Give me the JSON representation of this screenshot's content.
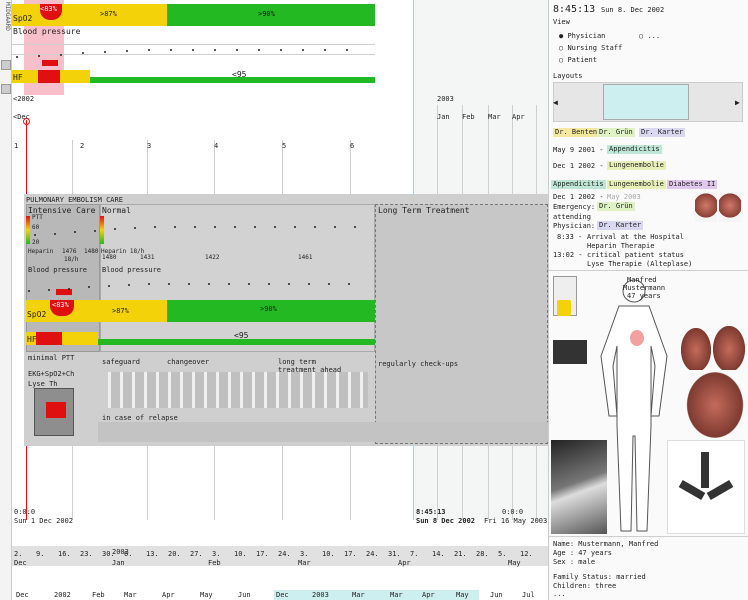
{
  "app": {
    "sidebar_brand": "MIDGAARD",
    "accent_green": "#22b922",
    "accent_yellow": "#f4d20a",
    "accent_red": "#e01010",
    "highlight_pink": "#f6b4c0",
    "highlight_cyan": "#cdeff0"
  },
  "overview": {
    "spo2_label": "SpO2",
    "spo2_bands": [
      "<83%",
      ">87%",
      ">90%"
    ],
    "bp_label": "Blood pressure",
    "hf_label": "HF",
    "hf_value": "<95",
    "left_marker": "<2002",
    "dec_marker": "<Dec",
    "year_2003": "2003",
    "months": [
      "Jan",
      "Feb",
      "Mar",
      "Apr"
    ],
    "day_ticks": [
      "1",
      "2",
      "3",
      "4",
      "5",
      "6"
    ]
  },
  "detail": {
    "section_title": "PULMONARY EMBOLISM CARE",
    "intensive_care": "Intensive Care",
    "normal": "Normal",
    "long_term": "Long Term Treatment",
    "heparin_a": "Heparin",
    "heparin_b": "Heparin 18/h",
    "heparin_values": [
      "1476",
      "1480",
      "1431",
      "1422",
      "1461",
      "1480"
    ],
    "rate": "18/h",
    "ptt_label": "PTT",
    "scale_60": "60",
    "scale_20": "20",
    "bp_label": "Blood pressure",
    "spo2_label": "SpO2",
    "spo2_bands": [
      "<83%",
      ">87%",
      ">90%"
    ],
    "hf_label": "HF",
    "hf_value": "<95",
    "minimal_ptt": "minimal PTT",
    "ekg": "EKG+SpO2+Ch",
    "lyse": "Lyse Th",
    "safeguard": "safeguard",
    "changeover": "changeover",
    "long_term_ahead_1": "long term",
    "long_term_ahead_2": "treatment ahead",
    "checkups": "regularly check-ups",
    "relapse": "in case of relapse"
  },
  "timeline": {
    "start_time": "0:0:0",
    "start_date": "Sun 1 Dec 2002",
    "now_time": "8:45:13",
    "now_date": "Sun 8 Dec 2002",
    "end_time": "0:0:0",
    "end_date": "Fri 16 May 2003",
    "day_row": [
      "2.",
      "9.",
      "16.",
      "23.",
      "30.",
      "6.",
      "13.",
      "20.",
      "27.",
      "3.",
      "10.",
      "17.",
      "24.",
      "3.",
      "10.",
      "17.",
      "24.",
      "31.",
      "7.",
      "14.",
      "21.",
      "28.",
      "5.",
      "12."
    ],
    "month_row": [
      "Dec",
      "Jan",
      "Feb",
      "Mar",
      "Apr",
      "May"
    ],
    "year_row_label": "2003",
    "bottom_row_left": [
      "Dec",
      "2002",
      "Feb",
      "Mar",
      "Apr",
      "May",
      "Jun"
    ],
    "bottom_row_right": [
      "Dec",
      "2003",
      "Mar",
      "Mar",
      "Apr",
      "May",
      "Jun",
      "Jul"
    ]
  },
  "right": {
    "clock": "8:45:13",
    "date": "Sun 8. Dec 2002",
    "view_title": "View",
    "view_options": [
      "Physician",
      "Nursing Staff",
      "Patient"
    ],
    "view_more": "...",
    "layouts_title": "Layouts",
    "doctors": [
      "Dr. Benten",
      "Dr. Grün",
      "Dr. Karter"
    ],
    "history": [
      {
        "date": "May 9 2001 -",
        "tag": "Appendicitis"
      },
      {
        "date": "Dec 1 2002 -",
        "tag": "Lungenembolie"
      }
    ],
    "diagnosis_tabs": [
      "Appendicitis",
      "Lungenembolie",
      "Diabetes II"
    ],
    "episode_date": "Dec 1 2002 -",
    "episode_end": "May 2003",
    "emergency_label": "Emergency:",
    "emergency_doctor": "Dr. Grün",
    "attending_label": "attending",
    "physician_label": "Physician:",
    "physician_doctor": "Dr. Karter",
    "events": [
      {
        "time": "8:33 -",
        "text": "Arrival at the Hospital"
      },
      {
        "time": "",
        "text": "Heparin Therapie"
      },
      {
        "time": "13:02 -",
        "text": "critical patient status"
      },
      {
        "time": "",
        "text": "Lyse Therapie (Alteplase)"
      }
    ],
    "patient_name_short": "Manfred",
    "patient_name_full": "Mustermann",
    "patient_age": "47 years",
    "info_lines": [
      "Name: Mustermann, Manfred",
      "Age : 47 years",
      "Sex : male",
      "",
      "Family Status: married",
      "Children: three",
      "..."
    ]
  }
}
